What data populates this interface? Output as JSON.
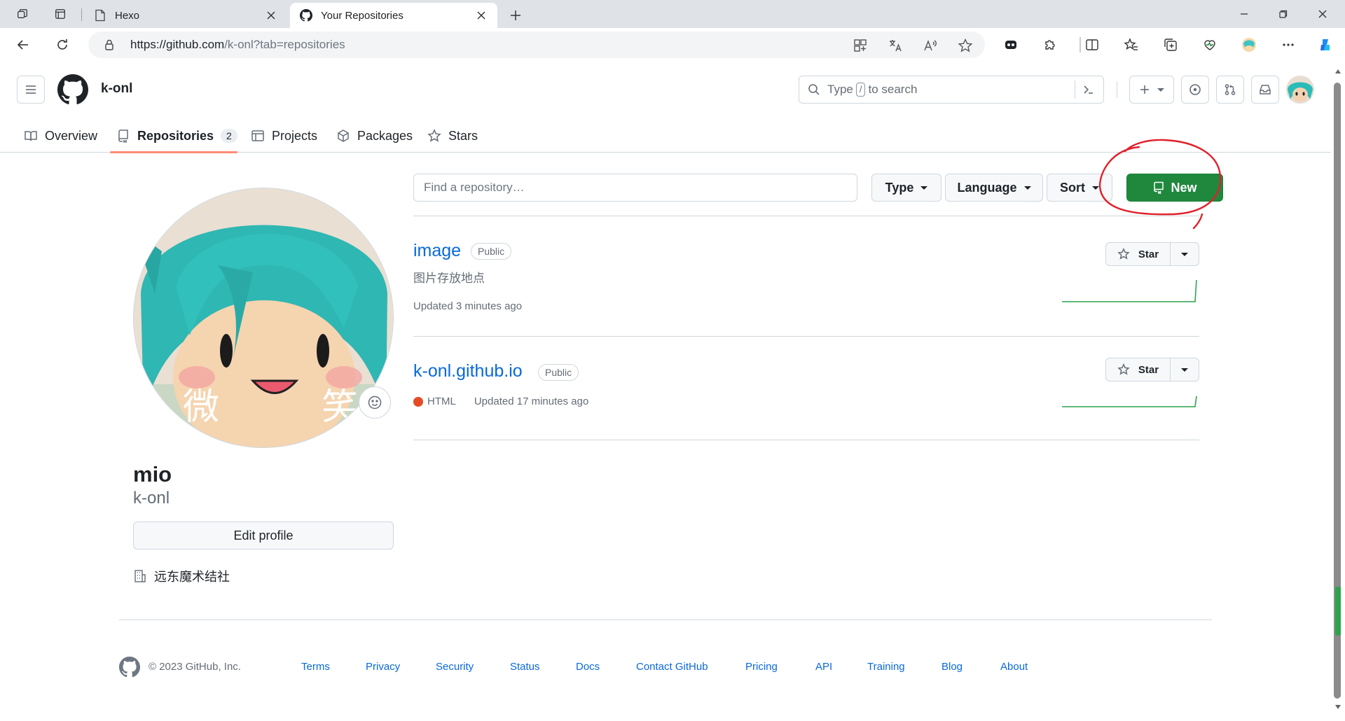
{
  "browser": {
    "tabs": [
      {
        "title": "Hexo",
        "active": false
      },
      {
        "title": "Your Repositories",
        "active": true
      }
    ],
    "url_host": "https://github.com",
    "url_path": "/k-onl?tab=repositories"
  },
  "header": {
    "owner": "k-onl",
    "search_prefix": "Type",
    "search_key": "/",
    "search_suffix": "to search"
  },
  "nav": {
    "items": [
      {
        "label": "Overview"
      },
      {
        "label": "Repositories",
        "count": "2"
      },
      {
        "label": "Projects"
      },
      {
        "label": "Packages"
      },
      {
        "label": "Stars"
      }
    ]
  },
  "profile": {
    "name": "mio",
    "login": "k-onl",
    "edit_label": "Edit profile",
    "organization": "远东魔术结社",
    "avatar_overlay": [
      "微",
      "笑"
    ]
  },
  "filters": {
    "find_placeholder": "Find a repository…",
    "type_label": "Type",
    "language_label": "Language",
    "sort_label": "Sort",
    "new_label": "New"
  },
  "repos": [
    {
      "name": "image",
      "visibility": "Public",
      "description": "图片存放地点",
      "language": "",
      "updated": "Updated 3 minutes ago",
      "star_label": "Star"
    },
    {
      "name": "k-onl.github.io",
      "visibility": "Public",
      "description": "",
      "language": "HTML",
      "language_color": "#e34c26",
      "updated": "Updated 17 minutes ago",
      "star_label": "Star"
    }
  ],
  "footer": {
    "copyright": "© 2023 GitHub, Inc.",
    "links": [
      "Terms",
      "Privacy",
      "Security",
      "Status",
      "Docs",
      "Contact GitHub",
      "Pricing",
      "API",
      "Training",
      "Blog",
      "About"
    ]
  },
  "colors": {
    "accent_green": "#1f883d",
    "link_blue": "#0969da",
    "nav_underline": "#fd8c73",
    "annotation_red": "#e0202a"
  }
}
